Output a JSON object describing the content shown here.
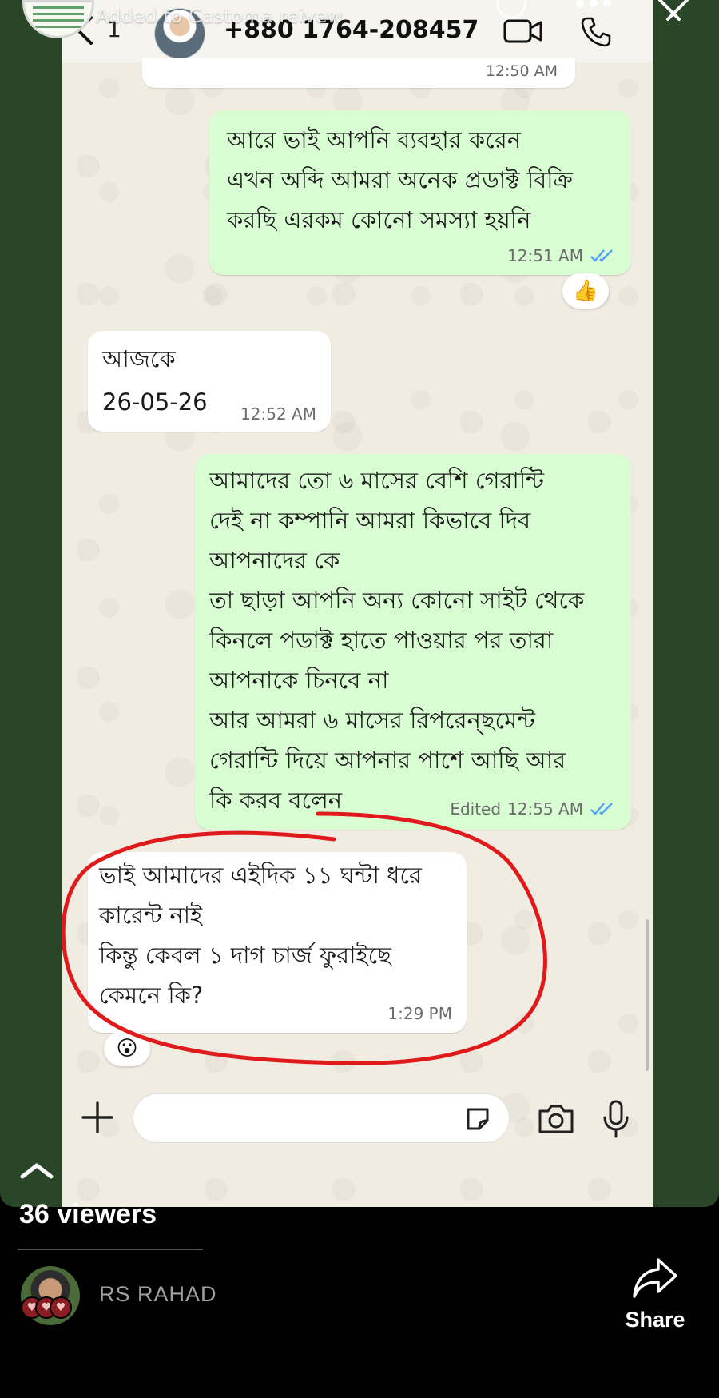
{
  "story": {
    "added_to": "Added to Castoma reivew",
    "viewers": "36 viewers",
    "viewer_name": "RS RAHAD",
    "share_label": "Share"
  },
  "chat": {
    "back_count": "1",
    "contact": "+880 1764-208457",
    "prev_time": "12:50 AM",
    "messages": [
      {
        "dir": "out",
        "text": "আরে ভাই আপনি ব্যবহার করেন\nএখন অব্দি আমরা অনেক প্রডাক্ট বিক্রি\nকরছি এরকম কোনো সমস্যা হয়নি",
        "time": "12:51 AM",
        "reaction": "👍"
      },
      {
        "dir": "in",
        "text": "আজকে\n26-05-26",
        "time": "12:52 AM"
      },
      {
        "dir": "out",
        "text": "আমাদের তো ৬ মাসের বেশি  গেরান্টি\nদেই না কম্পানি আমরা কিভাবে দিব\nআপনাদের কে\nতা ছাড়া আপনি অন্য কোনো সাইট থেকে\nকিনলে পডাক্ট হাতে পাওয়ার পর তারা\nআপনাকে চিনবে না\nআর আমরা ৬ মাসের রিপরেন্ছমেন্ট\nগেরান্টি দিয়ে আপনার পাশে আছি আর\nকি করব বলেন",
        "edited": "Edited",
        "time": "12:55 AM"
      },
      {
        "dir": "in",
        "text": "ভাই আমাদের এইদিক ১১ ঘন্টা ধরে\nকারেন্ট নাই\nকিন্তু কেবল ১ দাগ চার্জ ফুরাইছে\nকেমনে কি?",
        "time": "1:29 PM",
        "reaction": "😮"
      }
    ]
  },
  "colors": {
    "outgoing_bubble": "#d9fdd3",
    "incoming_bubble": "#ffffff",
    "read_ticks": "#4fa3f7",
    "annotation_red": "#e01a1a",
    "story_background": "#2a4629"
  },
  "icons": {
    "back": "chevron-left-icon",
    "video": "video-camera-icon",
    "call": "phone-icon",
    "attach": "plus-icon",
    "sticker": "sticker-icon",
    "camera": "camera-icon",
    "mic": "microphone-icon",
    "expand": "chevron-up-icon",
    "share": "share-arrow-icon",
    "close": "close-icon",
    "more": "more-dots-icon"
  }
}
